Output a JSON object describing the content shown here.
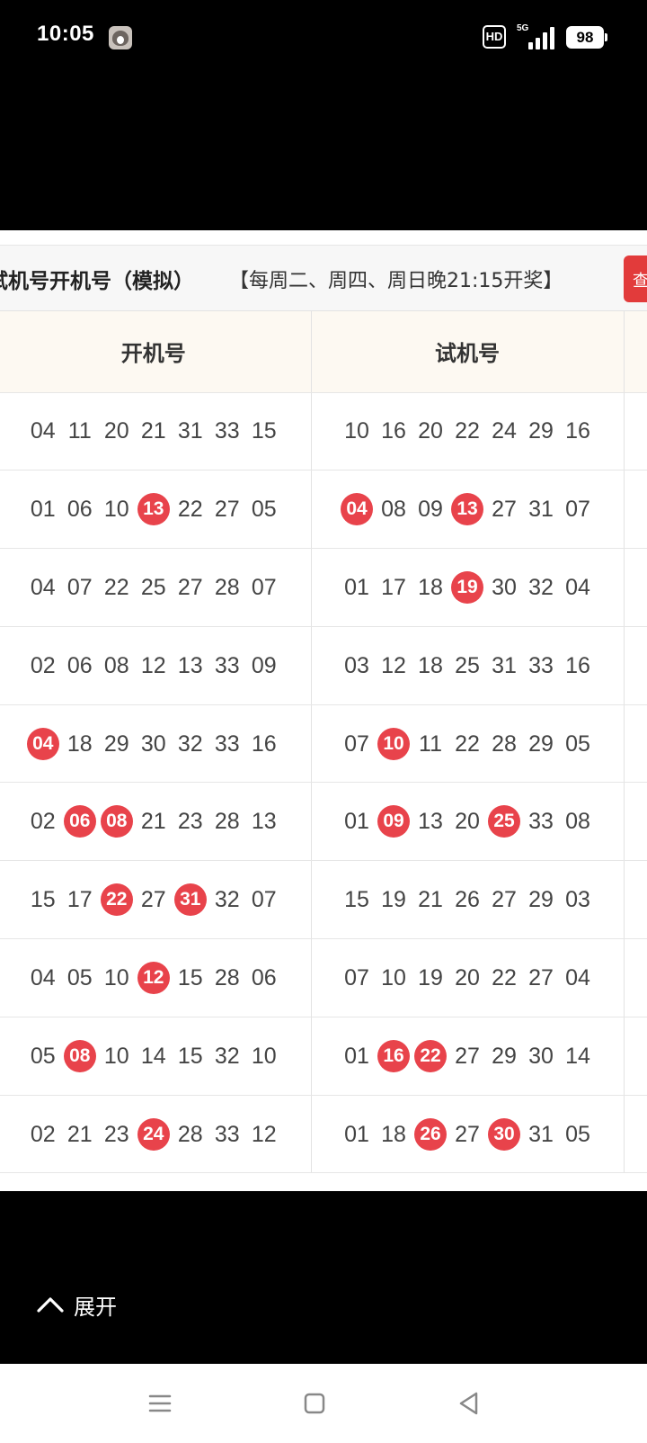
{
  "status_bar": {
    "time": "10:05",
    "hd_label": "HD",
    "network_label": "5G",
    "battery_level": "98",
    "app_icon": "dog-avatar-icon",
    "signal_icon": "cellular-signal-icon"
  },
  "header": {
    "title": "试机号开机号（模拟）",
    "schedule_note": "【每周二、周四、周日晚21:15开奖】",
    "action_button_label": "查"
  },
  "table": {
    "columns": [
      "开机号",
      "试机号"
    ],
    "rows": [
      {
        "open": [
          {
            "n": "04",
            "hit": false
          },
          {
            "n": "11",
            "hit": false
          },
          {
            "n": "20",
            "hit": false
          },
          {
            "n": "21",
            "hit": false
          },
          {
            "n": "31",
            "hit": false
          },
          {
            "n": "33",
            "hit": false
          },
          {
            "n": "15",
            "hit": false
          }
        ],
        "trial": [
          {
            "n": "10",
            "hit": false
          },
          {
            "n": "16",
            "hit": false
          },
          {
            "n": "20",
            "hit": false
          },
          {
            "n": "22",
            "hit": false
          },
          {
            "n": "24",
            "hit": false
          },
          {
            "n": "29",
            "hit": false
          },
          {
            "n": "16",
            "hit": false
          }
        ]
      },
      {
        "open": [
          {
            "n": "01",
            "hit": false
          },
          {
            "n": "06",
            "hit": false
          },
          {
            "n": "10",
            "hit": false
          },
          {
            "n": "13",
            "hit": true
          },
          {
            "n": "22",
            "hit": false
          },
          {
            "n": "27",
            "hit": false
          },
          {
            "n": "05",
            "hit": false
          }
        ],
        "trial": [
          {
            "n": "04",
            "hit": true
          },
          {
            "n": "08",
            "hit": false
          },
          {
            "n": "09",
            "hit": false
          },
          {
            "n": "13",
            "hit": true
          },
          {
            "n": "27",
            "hit": false
          },
          {
            "n": "31",
            "hit": false
          },
          {
            "n": "07",
            "hit": false
          }
        ]
      },
      {
        "open": [
          {
            "n": "04",
            "hit": false
          },
          {
            "n": "07",
            "hit": false
          },
          {
            "n": "22",
            "hit": false
          },
          {
            "n": "25",
            "hit": false
          },
          {
            "n": "27",
            "hit": false
          },
          {
            "n": "28",
            "hit": false
          },
          {
            "n": "07",
            "hit": false
          }
        ],
        "trial": [
          {
            "n": "01",
            "hit": false
          },
          {
            "n": "17",
            "hit": false
          },
          {
            "n": "18",
            "hit": false
          },
          {
            "n": "19",
            "hit": true
          },
          {
            "n": "30",
            "hit": false
          },
          {
            "n": "32",
            "hit": false
          },
          {
            "n": "04",
            "hit": false
          }
        ]
      },
      {
        "open": [
          {
            "n": "02",
            "hit": false
          },
          {
            "n": "06",
            "hit": false
          },
          {
            "n": "08",
            "hit": false
          },
          {
            "n": "12",
            "hit": false
          },
          {
            "n": "13",
            "hit": false
          },
          {
            "n": "33",
            "hit": false
          },
          {
            "n": "09",
            "hit": false
          }
        ],
        "trial": [
          {
            "n": "03",
            "hit": false
          },
          {
            "n": "12",
            "hit": false
          },
          {
            "n": "18",
            "hit": false
          },
          {
            "n": "25",
            "hit": false
          },
          {
            "n": "31",
            "hit": false
          },
          {
            "n": "33",
            "hit": false
          },
          {
            "n": "16",
            "hit": false
          }
        ]
      },
      {
        "open": [
          {
            "n": "04",
            "hit": true
          },
          {
            "n": "18",
            "hit": false
          },
          {
            "n": "29",
            "hit": false
          },
          {
            "n": "30",
            "hit": false
          },
          {
            "n": "32",
            "hit": false
          },
          {
            "n": "33",
            "hit": false
          },
          {
            "n": "16",
            "hit": false
          }
        ],
        "trial": [
          {
            "n": "07",
            "hit": false
          },
          {
            "n": "10",
            "hit": true
          },
          {
            "n": "11",
            "hit": false
          },
          {
            "n": "22",
            "hit": false
          },
          {
            "n": "28",
            "hit": false
          },
          {
            "n": "29",
            "hit": false
          },
          {
            "n": "05",
            "hit": false
          }
        ]
      },
      {
        "open": [
          {
            "n": "02",
            "hit": false
          },
          {
            "n": "06",
            "hit": true
          },
          {
            "n": "08",
            "hit": true
          },
          {
            "n": "21",
            "hit": false
          },
          {
            "n": "23",
            "hit": false
          },
          {
            "n": "28",
            "hit": false
          },
          {
            "n": "13",
            "hit": false
          }
        ],
        "trial": [
          {
            "n": "01",
            "hit": false
          },
          {
            "n": "09",
            "hit": true
          },
          {
            "n": "13",
            "hit": false
          },
          {
            "n": "20",
            "hit": false
          },
          {
            "n": "25",
            "hit": true
          },
          {
            "n": "33",
            "hit": false
          },
          {
            "n": "08",
            "hit": false
          }
        ]
      },
      {
        "open": [
          {
            "n": "15",
            "hit": false
          },
          {
            "n": "17",
            "hit": false
          },
          {
            "n": "22",
            "hit": true
          },
          {
            "n": "27",
            "hit": false
          },
          {
            "n": "31",
            "hit": true
          },
          {
            "n": "32",
            "hit": false
          },
          {
            "n": "07",
            "hit": false
          }
        ],
        "trial": [
          {
            "n": "15",
            "hit": false
          },
          {
            "n": "19",
            "hit": false
          },
          {
            "n": "21",
            "hit": false
          },
          {
            "n": "26",
            "hit": false
          },
          {
            "n": "27",
            "hit": false
          },
          {
            "n": "29",
            "hit": false
          },
          {
            "n": "03",
            "hit": false
          }
        ]
      },
      {
        "open": [
          {
            "n": "04",
            "hit": false
          },
          {
            "n": "05",
            "hit": false
          },
          {
            "n": "10",
            "hit": false
          },
          {
            "n": "12",
            "hit": true
          },
          {
            "n": "15",
            "hit": false
          },
          {
            "n": "28",
            "hit": false
          },
          {
            "n": "06",
            "hit": false
          }
        ],
        "trial": [
          {
            "n": "07",
            "hit": false
          },
          {
            "n": "10",
            "hit": false
          },
          {
            "n": "19",
            "hit": false
          },
          {
            "n": "20",
            "hit": false
          },
          {
            "n": "22",
            "hit": false
          },
          {
            "n": "27",
            "hit": false
          },
          {
            "n": "04",
            "hit": false
          }
        ]
      },
      {
        "open": [
          {
            "n": "05",
            "hit": false
          },
          {
            "n": "08",
            "hit": true
          },
          {
            "n": "10",
            "hit": false
          },
          {
            "n": "14",
            "hit": false
          },
          {
            "n": "15",
            "hit": false
          },
          {
            "n": "32",
            "hit": false
          },
          {
            "n": "10",
            "hit": false
          }
        ],
        "trial": [
          {
            "n": "01",
            "hit": false
          },
          {
            "n": "16",
            "hit": true
          },
          {
            "n": "22",
            "hit": true
          },
          {
            "n": "27",
            "hit": false
          },
          {
            "n": "29",
            "hit": false
          },
          {
            "n": "30",
            "hit": false
          },
          {
            "n": "14",
            "hit": false
          }
        ]
      },
      {
        "open": [
          {
            "n": "02",
            "hit": false
          },
          {
            "n": "21",
            "hit": false
          },
          {
            "n": "23",
            "hit": false
          },
          {
            "n": "24",
            "hit": true
          },
          {
            "n": "28",
            "hit": false
          },
          {
            "n": "33",
            "hit": false
          },
          {
            "n": "12",
            "hit": false
          }
        ],
        "trial": [
          {
            "n": "01",
            "hit": false
          },
          {
            "n": "18",
            "hit": false
          },
          {
            "n": "26",
            "hit": true
          },
          {
            "n": "27",
            "hit": false
          },
          {
            "n": "30",
            "hit": true
          },
          {
            "n": "31",
            "hit": false
          },
          {
            "n": "05",
            "hit": false
          }
        ]
      }
    ]
  },
  "expand": {
    "label": "展开",
    "icon": "chevron-up-icon"
  },
  "nav_bar": {
    "menu_icon": "menu-icon",
    "home_icon": "home-square-icon",
    "back_icon": "back-triangle-icon"
  },
  "colors": {
    "hit_ball": "#e8434b",
    "action_button": "#e23b3b",
    "header_row_bg": "#fdf9f2"
  }
}
